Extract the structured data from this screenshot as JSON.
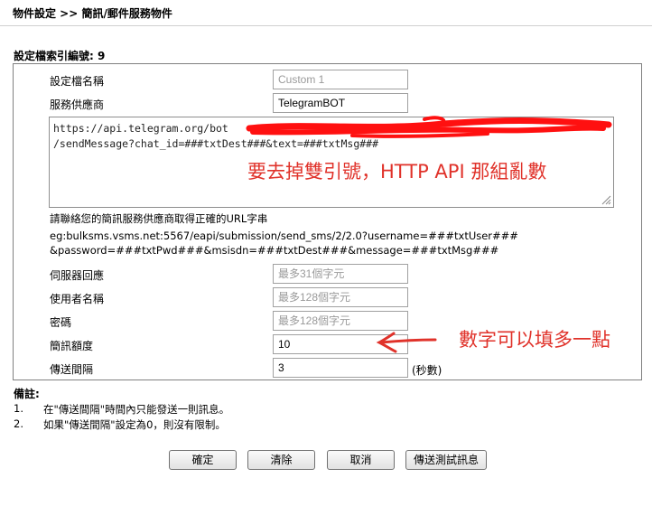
{
  "header": {
    "title": "物件設定 >> 簡訊/郵件服務物件"
  },
  "profile": {
    "index_label": "設定檔索引編號:",
    "index_value": "9"
  },
  "form": {
    "profile_name": {
      "label": "設定檔名稱",
      "placeholder": "Custom 1"
    },
    "provider": {
      "label": "服務供應商",
      "value": "TelegramBOT"
    },
    "url": {
      "line1": "https://api.telegram.org/bot",
      "line2": "/sendMessage?chat_id=###txtDest###&text=###txtMsg###"
    },
    "url_hint": {
      "line1": "請聯絡您的簡訊服務供應商取得正確的URL字串",
      "line2": "eg:bulksms.vsms.net:5567/eapi/submission/send_sms/2/2.0?username=###txtUser###",
      "line3": "&password=###txtPwd###&msisdn=###txtDest###&message=###txtMsg###"
    },
    "server_response": {
      "label": "伺服器回應",
      "placeholder": "最多31個字元"
    },
    "username": {
      "label": "使用者名稱",
      "placeholder": "最多128個字元"
    },
    "password": {
      "label": "密碼",
      "placeholder": "最多128個字元"
    },
    "quota": {
      "label": "簡訊額度",
      "value": "10"
    },
    "interval": {
      "label": "傳送間隔",
      "value": "3",
      "unit": "(秒數)"
    }
  },
  "annotations": {
    "quote_note": "要去掉雙引號，HTTP API 那組亂數",
    "quota_note": "數字可以填多一點"
  },
  "notes": {
    "title": "備註:",
    "items": [
      {
        "num": "1.",
        "text": "在\"傳送間隔\"時間內只能發送一則訊息。"
      },
      {
        "num": "2.",
        "text": "如果\"傳送間隔\"設定為0，則沒有限制。"
      }
    ]
  },
  "buttons": {
    "ok": "確定",
    "clear": "清除",
    "cancel": "取消",
    "send_test": "傳送測試訊息"
  },
  "colors": {
    "annotation_red": "#e0322a",
    "redaction_red": "#ff1010"
  }
}
